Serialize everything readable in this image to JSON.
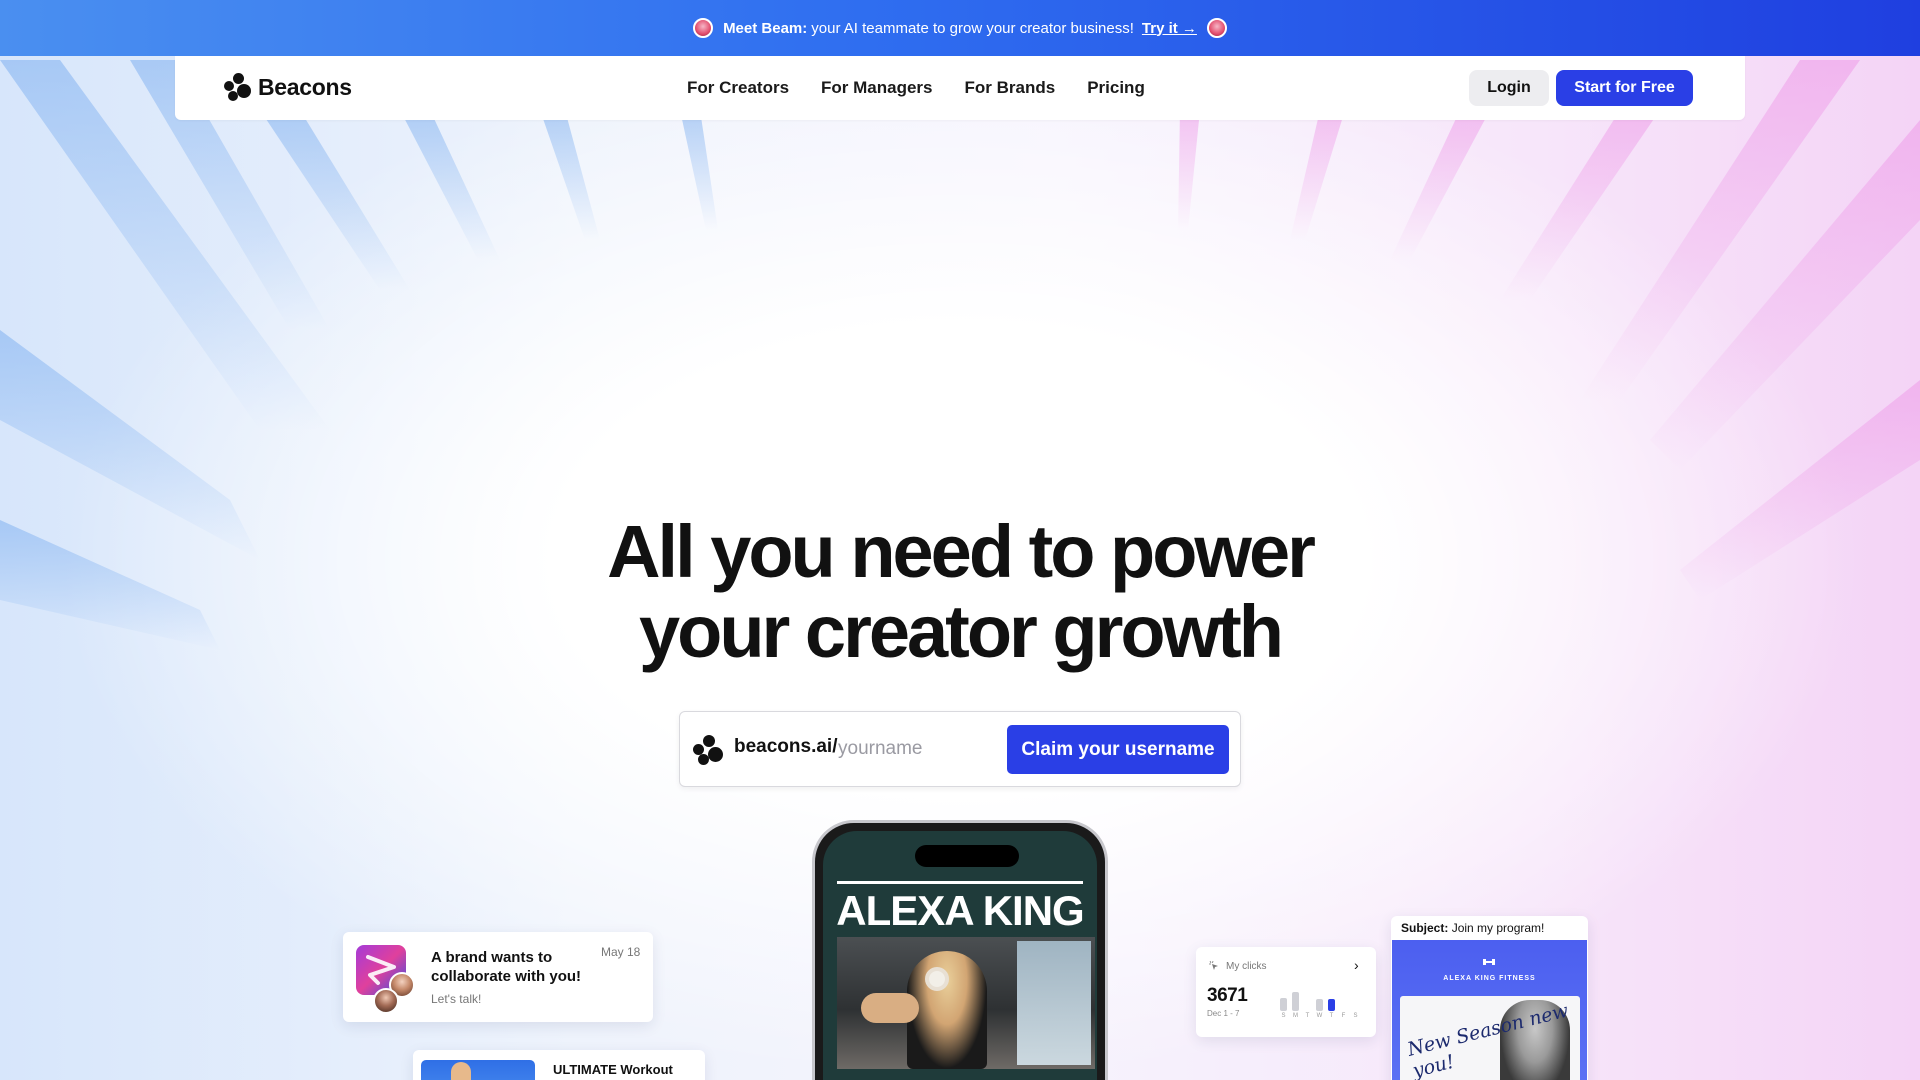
{
  "announcement": {
    "lead": "Meet Beam:",
    "text": "your AI teammate to grow your creator business!",
    "link": "Try it →"
  },
  "nav": {
    "brand": "Beacons",
    "links": [
      "For Creators",
      "For Managers",
      "For Brands",
      "Pricing"
    ],
    "login": "Login",
    "start": "Start for Free"
  },
  "hero": {
    "title_line1": "All you need to power",
    "title_line2": "your creator growth"
  },
  "claim": {
    "prefix": "beacons.ai/",
    "placeholder": "yourname",
    "button": "Claim your username"
  },
  "phone": {
    "name": "ALEXA KING"
  },
  "brand_card": {
    "title": "A brand wants to collaborate with you!",
    "subtitle": "Let's talk!",
    "date": "May 18"
  },
  "workout_card": {
    "title": "ULTIMATE Workout"
  },
  "clicks_card": {
    "label": "My clicks",
    "value": "3671",
    "range": "Dec 1 - 7",
    "days": [
      "S",
      "M",
      "T",
      "W",
      "T",
      "F",
      "S"
    ],
    "bars": [
      0.6,
      0.85,
      0,
      0.55,
      0.55,
      0,
      0
    ],
    "active_day_index": 4
  },
  "email_card": {
    "subject_label": "Subject:",
    "subject": "Join my program!",
    "brand": "ALEXA KING FITNESS",
    "script": "New Season new you!"
  },
  "colors": {
    "primary": "#2a3fe6",
    "announce_start": "#4a8ff0",
    "announce_end": "#1f3fe0",
    "text": "#111111"
  }
}
